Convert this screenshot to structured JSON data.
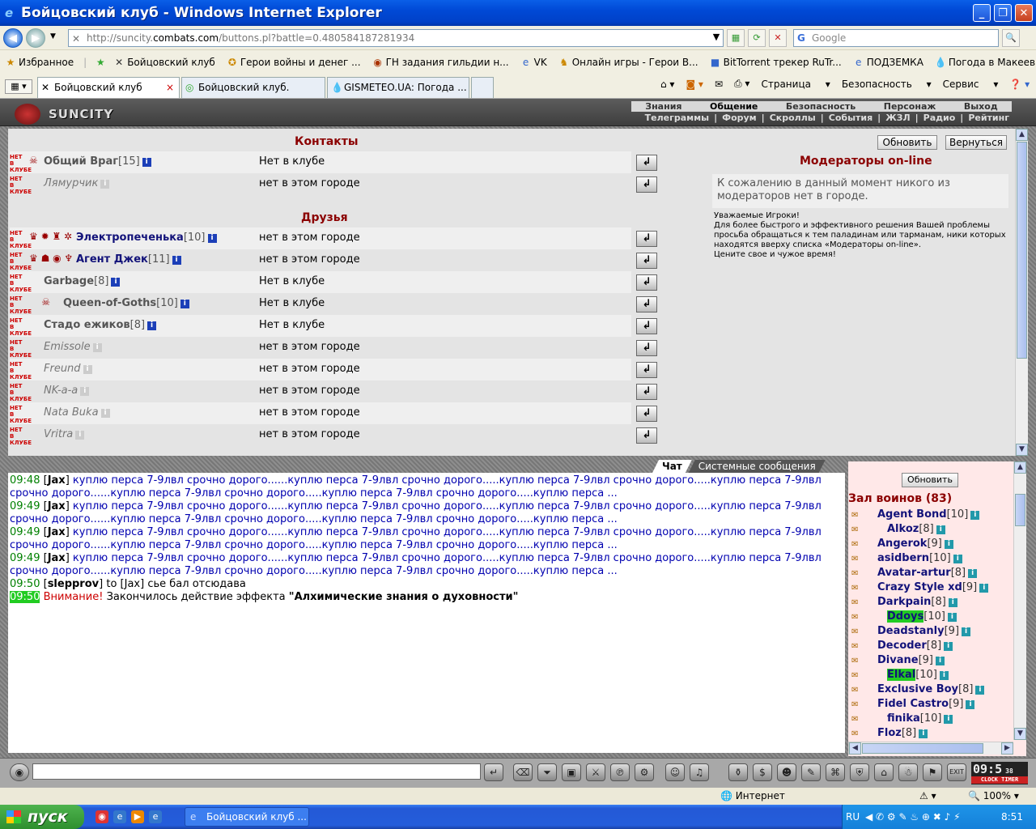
{
  "window": {
    "title": "Бойцовский клуб - Windows Internet Explorer"
  },
  "address": {
    "url_prefix": "http://suncity.",
    "url_domain": "combats.com",
    "url_rest": "/buttons.pl?battle=0.480584187281934",
    "search_placeholder": "Google"
  },
  "favorites": {
    "label": "Избранное",
    "items": [
      "Бойцовский клуб",
      "Герои войны и денег ...",
      "ГН задания гильдии н...",
      "VK",
      "Онлайн игры - Герои В...",
      "BitTorrent трекер RuTr...",
      "ПОДЗЕМКА",
      "Погода в Макеевке"
    ]
  },
  "tabs": [
    {
      "label": "Бойцовский клуб"
    },
    {
      "label": "Бойцовский клуб."
    },
    {
      "label": "GISMETEO.UA: Погода ..."
    }
  ],
  "commandbar": {
    "page": "Страница",
    "safety": "Безопасность",
    "tools": "Сервис"
  },
  "game": {
    "logo": "SUNCITY",
    "menu_top": [
      "Знания",
      "Общение",
      "Безопасность",
      "Персонаж",
      "Выход"
    ],
    "menu_bottom": [
      "Телеграммы",
      "|",
      "Форум",
      "|",
      "Скроллы",
      "|",
      "События",
      "|",
      "ЖЗЛ",
      "|",
      "Радио",
      "|",
      "Рейтинг"
    ],
    "contacts_title": "Контакты",
    "friends_title": "Друзья",
    "contacts": [
      {
        "name": "Общий Враг",
        "level": "[15]",
        "location": "Нет в клубе"
      },
      {
        "name": "Лямурчик",
        "level": "",
        "location": "нет в этом городе"
      }
    ],
    "friends": [
      {
        "name": "Электропеченька",
        "level": "[10]",
        "location": "нет в этом городе"
      },
      {
        "name": "Агент Джек",
        "level": "[11]",
        "location": "нет в этом городе"
      },
      {
        "name": "Garbage",
        "level": "[8]",
        "location": "Нет в клубе"
      },
      {
        "name": "Queen-of-Goths",
        "level": "[10]",
        "location": "Нет в клубе"
      },
      {
        "name": "Стадо ежиков",
        "level": "[8]",
        "location": "Нет в клубе"
      },
      {
        "name": "Emissole",
        "level": "",
        "location": "нет в этом городе"
      },
      {
        "name": "Freund",
        "level": "",
        "location": "нет в этом городе"
      },
      {
        "name": "NK-a-a",
        "level": "",
        "location": "нет в этом городе"
      },
      {
        "name": "Nata Buka",
        "level": "",
        "location": "нет в этом городе"
      },
      {
        "name": "Vritra",
        "level": "",
        "location": "нет в этом городе"
      }
    ],
    "offline_tag": "НЕТ В КЛУБЕ",
    "refresh_label": "Обновить",
    "back_label": "Вернуться",
    "moderators_title": "Модераторы on-line",
    "moderators_empty": "К сожалению в данный момент никого из модераторов нет в городе.",
    "moderators_note": "Уважаемые Игроки!\nДля более быстрого и эффективного решения Вашей проблемы просьба обращаться к тем паладинам или тарманам, ники которых находятся вверху списка «Модераторы on-line».\nЦените свое и чужое время!",
    "chat_tab": "Чат",
    "system_tab": "Системные сообщения",
    "chat": [
      {
        "time": "09:48",
        "nick": "Jax",
        "text": "куплю перса 7-9лвл срочно дорого......куплю перса 7-9лвл срочно дорого.....куплю перса 7-9лвл срочно дорого.....куплю перса 7-9лвл срочно дорого......куплю перса 7-9лвл срочно дорого.....куплю перса 7-9лвл срочно дорого.....куплю перса ..."
      },
      {
        "time": "09:49",
        "nick": "Jax",
        "text": "куплю перса 7-9лвл срочно дорого......куплю перса 7-9лвл срочно дорого.....куплю перса 7-9лвл срочно дорого.....куплю перса 7-9лвл срочно дорого......куплю перса 7-9лвл срочно дорого.....куплю перса 7-9лвл срочно дорого.....куплю перса ..."
      },
      {
        "time": "09:49",
        "nick": "Jax",
        "text": "куплю перса 7-9лвл срочно дорого......куплю перса 7-9лвл срочно дорого.....куплю перса 7-9лвл срочно дорого.....куплю перса 7-9лвл срочно дорого......куплю перса 7-9лвл срочно дорого.....куплю перса 7-9лвл срочно дорого.....куплю перса ..."
      },
      {
        "time": "09:49",
        "nick": "Jax",
        "text": "куплю перса 7-9лвл срочно дорого......куплю перса 7-9лвл срочно дорого.....куплю перса 7-9лвл срочно дорого.....куплю перса 7-9лвл срочно дорого......куплю перса 7-9лвл срочно дорого.....куплю перса 7-9лвл срочно дорого.....куплю перса ..."
      }
    ],
    "chat_last": {
      "time": "09:50",
      "nick": "slepprov",
      "to": "to [Jax]",
      "text": "сье бал отсюдава"
    },
    "system_msg": {
      "time": "09:50",
      "warn": "Внимание!",
      "text": "Закончилось действие эффекта",
      "effect": "\"Алхимические знания о духовности\""
    },
    "room_refresh": "Обновить",
    "room_title": "Зал воинов (83)",
    "room_users": [
      {
        "name": "Agent Bond",
        "level": "[10]"
      },
      {
        "name": "Alkoz",
        "level": "[8]"
      },
      {
        "name": "Angerok",
        "level": "[9]"
      },
      {
        "name": "asidbern",
        "level": "[10]"
      },
      {
        "name": "Avatar-artur",
        "level": "[8]"
      },
      {
        "name": "Crazy Style xd",
        "level": "[9]"
      },
      {
        "name": "Darkpain",
        "level": "[8]"
      },
      {
        "name": "Ddoys",
        "level": "[10]"
      },
      {
        "name": "Deadstanly",
        "level": "[9]"
      },
      {
        "name": "Decoder",
        "level": "[8]"
      },
      {
        "name": "Divane",
        "level": "[9]"
      },
      {
        "name": "Elkal",
        "level": "[10]"
      },
      {
        "name": "Exclusive Boy",
        "level": "[8]"
      },
      {
        "name": "Fidel Castro",
        "level": "[9]"
      },
      {
        "name": "finika",
        "level": "[10]"
      },
      {
        "name": "Floz",
        "level": "[8]"
      }
    ],
    "clock": {
      "time": "09:5",
      "seconds": "38",
      "label": "CLOCK TIMER"
    }
  },
  "status": {
    "zone": "Интернет",
    "zoom": "100%"
  },
  "taskbar": {
    "start": "пуск",
    "task": "Бойцовский клуб ...",
    "lang": "RU",
    "time": "8:51"
  }
}
